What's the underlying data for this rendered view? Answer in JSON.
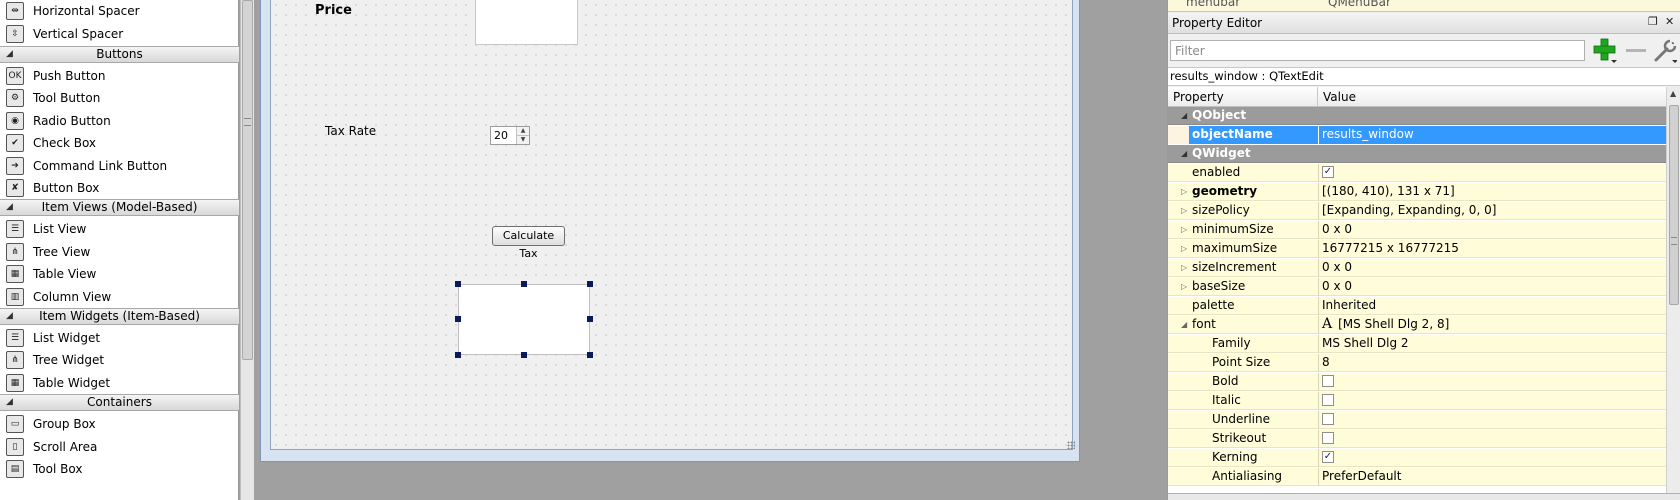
{
  "widget_box": {
    "items": [
      {
        "label": "Horizontal Spacer",
        "icon": "horizontal-spacer-icon",
        "glyph": "⇹"
      },
      {
        "label": "Vertical Spacer",
        "icon": "vertical-spacer-icon",
        "glyph": "⇳"
      },
      {
        "category": "Buttons"
      },
      {
        "label": "Push Button",
        "icon": "push-button-icon",
        "glyph": "OK"
      },
      {
        "label": "Tool Button",
        "icon": "tool-button-icon",
        "glyph": "⚙"
      },
      {
        "label": "Radio Button",
        "icon": "radio-button-icon",
        "glyph": "◉"
      },
      {
        "label": "Check Box",
        "icon": "check-box-icon",
        "glyph": "✔"
      },
      {
        "label": "Command Link Button",
        "icon": "command-link-button-icon",
        "glyph": "➔"
      },
      {
        "label": "Button Box",
        "icon": "button-box-icon",
        "glyph": "✘"
      },
      {
        "category": "Item Views (Model-Based)"
      },
      {
        "label": "List View",
        "icon": "list-view-icon",
        "glyph": "☰"
      },
      {
        "label": "Tree View",
        "icon": "tree-view-icon",
        "glyph": "⋔"
      },
      {
        "label": "Table View",
        "icon": "table-view-icon",
        "glyph": "▦"
      },
      {
        "label": "Column View",
        "icon": "column-view-icon",
        "glyph": "▥"
      },
      {
        "category": "Item Widgets (Item-Based)"
      },
      {
        "label": "List Widget",
        "icon": "list-widget-icon",
        "glyph": "☰"
      },
      {
        "label": "Tree Widget",
        "icon": "tree-widget-icon",
        "glyph": "⋔"
      },
      {
        "label": "Table Widget",
        "icon": "table-widget-icon",
        "glyph": "▦"
      },
      {
        "category": "Containers"
      },
      {
        "label": "Group Box",
        "icon": "group-box-icon",
        "glyph": "▭"
      },
      {
        "label": "Scroll Area",
        "icon": "scroll-area-icon",
        "glyph": "▯"
      },
      {
        "label": "Tool Box",
        "icon": "tool-box-icon",
        "glyph": "▤"
      }
    ]
  },
  "form": {
    "price_label": "Price",
    "tax_rate_label": "Tax Rate",
    "tax_rate_value": "20",
    "calculate_button": "Calculate Tax"
  },
  "property_editor": {
    "top_row_name": "menubar",
    "top_row_value": "QMenuBar",
    "title": "Property Editor",
    "filter_placeholder": "Filter",
    "object_line": "results_window : QTextEdit",
    "header": {
      "property": "Property",
      "value": "Value"
    },
    "rows": [
      {
        "type": "group",
        "name": "QObject"
      },
      {
        "type": "selected",
        "name": "objectName",
        "value": "results_window",
        "bold": true
      },
      {
        "type": "group",
        "name": "QWidget"
      },
      {
        "type": "row",
        "name": "enabled",
        "checkbox": true,
        "checked": true
      },
      {
        "type": "row",
        "name": "geometry",
        "value": "[(180, 410), 131 x 71]",
        "bold": true,
        "expander": "▷"
      },
      {
        "type": "row",
        "name": "sizePolicy",
        "value": "[Expanding, Expanding, 0, 0]",
        "expander": "▷"
      },
      {
        "type": "row",
        "name": "minimumSize",
        "value": "0 x 0",
        "expander": "▷"
      },
      {
        "type": "row",
        "name": "maximumSize",
        "value": "16777215 x 16777215",
        "expander": "▷"
      },
      {
        "type": "row",
        "name": "sizeIncrement",
        "value": "0 x 0",
        "expander": "▷"
      },
      {
        "type": "row",
        "name": "baseSize",
        "value": "0 x 0",
        "expander": "▷"
      },
      {
        "type": "row",
        "name": "palette",
        "value": "Inherited"
      },
      {
        "type": "row",
        "name": "font",
        "value": "[MS Shell Dlg 2, 8]",
        "expander": "◢",
        "font_glyph": "A"
      },
      {
        "type": "sub",
        "name": "Family",
        "value": "MS Shell Dlg 2"
      },
      {
        "type": "sub",
        "name": "Point Size",
        "value": "8"
      },
      {
        "type": "sub",
        "name": "Bold",
        "checkbox": true,
        "checked": false
      },
      {
        "type": "sub",
        "name": "Italic",
        "checkbox": true,
        "checked": false
      },
      {
        "type": "sub",
        "name": "Underline",
        "checkbox": true,
        "checked": false
      },
      {
        "type": "sub",
        "name": "Strikeout",
        "checkbox": true,
        "checked": false
      },
      {
        "type": "sub",
        "name": "Kerning",
        "checkbox": true,
        "checked": true
      },
      {
        "type": "sub",
        "name": "Antialiasing",
        "value": "PreferDefault"
      }
    ]
  },
  "colors": {
    "selection": "#3399ff",
    "row_yellow": "#fefcd9",
    "group_gray": "#9b9b9b"
  }
}
